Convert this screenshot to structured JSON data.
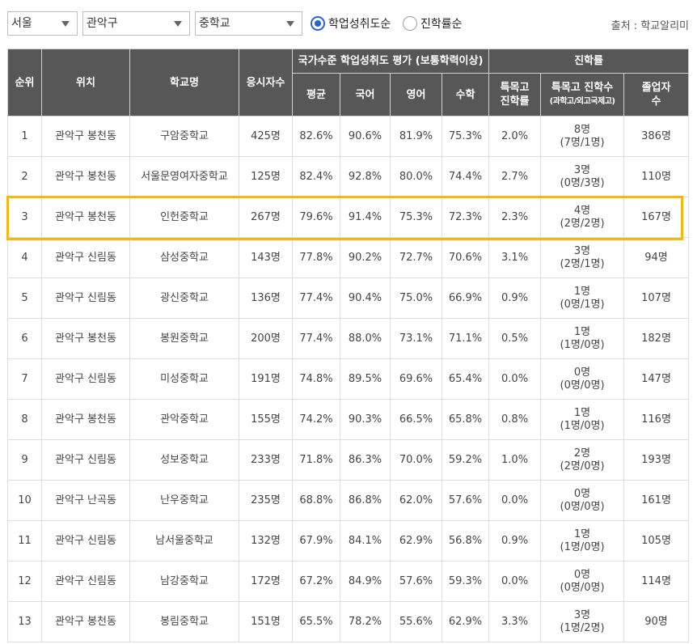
{
  "filters": {
    "region": "서울",
    "district": "관악구",
    "school_type": "중학교"
  },
  "sort": {
    "options": [
      "학업성취도순",
      "진학률순"
    ],
    "selected": "학업성취도순"
  },
  "source": "출처 : 학교알리미",
  "headers": {
    "rank": "순위",
    "location": "위치",
    "school": "학교명",
    "testers_line1": "응시자수",
    "national_group": "국가수준 학업성취도 평가 (보통학력이상)",
    "avg": "평균",
    "korean": "국어",
    "english": "영어",
    "math": "수학",
    "advancement_group": "진학률",
    "special_rate_line1": "특목고",
    "special_rate_line2": "진학률",
    "special_count_line1": "특목고 진학수",
    "special_count_line2": "(과학고/외고국제고)",
    "grads_line1": "졸업자",
    "grads_line2": "수"
  },
  "rows": [
    {
      "rank": "1",
      "location": "관악구 봉천동",
      "school": "구암중학교",
      "testers": "425명",
      "avg": "82.6%",
      "kor": "90.6%",
      "eng": "81.9%",
      "math": "75.3%",
      "special_rate": "2.0%",
      "special_count": "8명",
      "special_detail": "(7명/1명)",
      "grads": "386명"
    },
    {
      "rank": "2",
      "location": "관악구 봉천동",
      "school": "서울문영여자중학교",
      "testers": "125명",
      "avg": "82.4%",
      "kor": "92.8%",
      "eng": "80.0%",
      "math": "74.4%",
      "special_rate": "2.7%",
      "special_count": "3명",
      "special_detail": "(0명/3명)",
      "grads": "110명"
    },
    {
      "rank": "3",
      "location": "관악구 봉천동",
      "school": "인헌중학교",
      "testers": "267명",
      "avg": "79.6%",
      "kor": "91.4%",
      "eng": "75.3%",
      "math": "72.3%",
      "special_rate": "2.3%",
      "special_count": "4명",
      "special_detail": "(2명/2명)",
      "grads": "167명"
    },
    {
      "rank": "4",
      "location": "관악구 신림동",
      "school": "삼성중학교",
      "testers": "143명",
      "avg": "77.8%",
      "kor": "90.2%",
      "eng": "72.7%",
      "math": "70.6%",
      "special_rate": "3.1%",
      "special_count": "3명",
      "special_detail": "(2명/1명)",
      "grads": "94명"
    },
    {
      "rank": "5",
      "location": "관악구 신림동",
      "school": "광신중학교",
      "testers": "136명",
      "avg": "77.4%",
      "kor": "90.4%",
      "eng": "75.0%",
      "math": "66.9%",
      "special_rate": "0.9%",
      "special_count": "1명",
      "special_detail": "(0명/1명)",
      "grads": "107명"
    },
    {
      "rank": "6",
      "location": "관악구 봉천동",
      "school": "봉원중학교",
      "testers": "200명",
      "avg": "77.4%",
      "kor": "88.0%",
      "eng": "73.1%",
      "math": "71.1%",
      "special_rate": "0.5%",
      "special_count": "1명",
      "special_detail": "(1명/0명)",
      "grads": "182명"
    },
    {
      "rank": "7",
      "location": "관악구 신림동",
      "school": "미성중학교",
      "testers": "191명",
      "avg": "74.8%",
      "kor": "89.5%",
      "eng": "69.6%",
      "math": "65.4%",
      "special_rate": "0.0%",
      "special_count": "0명",
      "special_detail": "(0명/0명)",
      "grads": "147명"
    },
    {
      "rank": "8",
      "location": "관악구 봉천동",
      "school": "관악중학교",
      "testers": "155명",
      "avg": "74.2%",
      "kor": "90.3%",
      "eng": "66.5%",
      "math": "65.8%",
      "special_rate": "0.8%",
      "special_count": "1명",
      "special_detail": "(1명/0명)",
      "grads": "116명"
    },
    {
      "rank": "9",
      "location": "관악구 신림동",
      "school": "성보중학교",
      "testers": "233명",
      "avg": "71.8%",
      "kor": "86.3%",
      "eng": "70.0%",
      "math": "59.2%",
      "special_rate": "1.0%",
      "special_count": "2명",
      "special_detail": "(2명/0명)",
      "grads": "193명"
    },
    {
      "rank": "10",
      "location": "관악구 난곡동",
      "school": "난우중학교",
      "testers": "235명",
      "avg": "68.8%",
      "kor": "86.8%",
      "eng": "62.0%",
      "math": "57.6%",
      "special_rate": "0.0%",
      "special_count": "0명",
      "special_detail": "(0명/0명)",
      "grads": "161명"
    },
    {
      "rank": "11",
      "location": "관악구 신림동",
      "school": "남서울중학교",
      "testers": "132명",
      "avg": "67.9%",
      "kor": "84.1%",
      "eng": "62.9%",
      "math": "56.8%",
      "special_rate": "0.9%",
      "special_count": "1명",
      "special_detail": "(1명/0명)",
      "grads": "105명"
    },
    {
      "rank": "12",
      "location": "관악구 신림동",
      "school": "남강중학교",
      "testers": "172명",
      "avg": "67.2%",
      "kor": "84.9%",
      "eng": "57.6%",
      "math": "59.3%",
      "special_rate": "0.0%",
      "special_count": "0명",
      "special_detail": "(0명/0명)",
      "grads": "114명"
    },
    {
      "rank": "13",
      "location": "관악구 봉천동",
      "school": "봉림중학교",
      "testers": "151명",
      "avg": "65.5%",
      "kor": "78.2%",
      "eng": "55.6%",
      "math": "62.9%",
      "special_rate": "3.3%",
      "special_count": "3명",
      "special_detail": "(1명/2명)",
      "grads": "90명"
    }
  ],
  "highlighted_rank": "3",
  "colors": {
    "header_bg": "#575757",
    "highlight": "#f3b814",
    "radio_accent": "#2a62d4"
  }
}
